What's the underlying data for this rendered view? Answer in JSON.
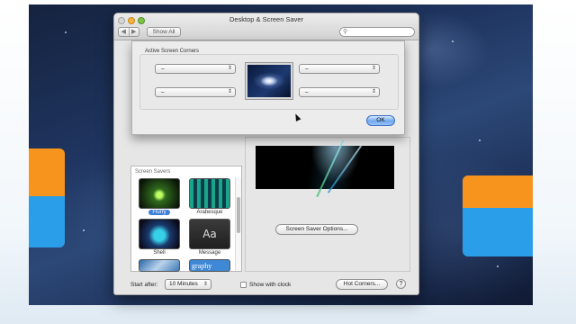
{
  "window": {
    "title": "Desktop & Screen Saver",
    "show_all": "Show All",
    "search_placeholder": "",
    "nav_back": "◀",
    "nav_forward": "▶"
  },
  "sheet": {
    "group_title": "Active Screen Corners",
    "corners": {
      "top_left": "–",
      "top_right": "–",
      "bottom_left": "–",
      "bottom_right": "–"
    },
    "ok_label": "OK"
  },
  "screen_savers": {
    "header": "Screen Savers",
    "items": [
      {
        "label": "Flurry",
        "selected": true,
        "icon": "flurry-thumbnail"
      },
      {
        "label": "Arabesque",
        "selected": false,
        "icon": "arabesque-thumbnail"
      },
      {
        "label": "Shell",
        "selected": false,
        "icon": "shell-thumbnail"
      },
      {
        "label": "Message",
        "selected": false,
        "icon": "message-thumbnail",
        "text": "Aa"
      },
      {
        "label": "",
        "selected": false,
        "icon": "photo-thumbnail"
      },
      {
        "label": "",
        "selected": false,
        "icon": "word-of-the-day-thumbnail",
        "text": "graphy lexico"
      }
    ]
  },
  "preview": {
    "options_label": "Screen Saver Options..."
  },
  "bottom": {
    "start_after_label": "Start after:",
    "start_after_value": "10 Minutes",
    "show_clock_label": "Show with clock",
    "show_clock_checked": false,
    "hot_corners_label": "Hot Corners...",
    "help_label": "?"
  },
  "colors": {
    "selection_blue": "#3c7fd9",
    "ok_blue": "#6fa8ee",
    "desktop_navy": "#1f3560",
    "tile_orange": "#f7941d",
    "tile_blue": "#2a9ee8"
  }
}
